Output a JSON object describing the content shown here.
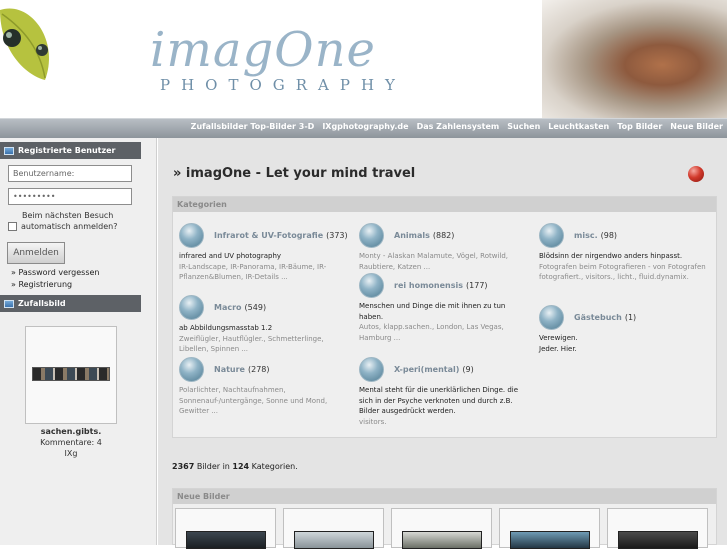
{
  "header": {
    "logo_text": "imagOne",
    "logo_subtitle": "PHOTOGRAPHY"
  },
  "nav": {
    "items": [
      "Zufallsbilder Top-Bilder 3-D",
      "IXgphotography.de",
      "Das Zahlensystem",
      "Suchen",
      "Leuchtkasten",
      "Top Bilder",
      "Neue Bilder"
    ]
  },
  "sidebar": {
    "login_header": "Registrierte Benutzer",
    "username_placeholder": "Benutzername:",
    "password_value": "•••••••••",
    "remember_line1": "Beim nächsten Besuch",
    "remember_line2": "automatisch anmelden?",
    "login_button": "Anmelden",
    "link_forgot": "» Password vergessen",
    "link_register": "» Registrierung",
    "random_header": "Zufallsbild",
    "random_title": "sachen.gibts.",
    "random_comments": "Kommentare: 4",
    "random_author": "IXg"
  },
  "main": {
    "title": "» imagOne - Let your mind travel",
    "categories_label": "Kategorien",
    "categories": [
      {
        "name": "Infrarot & UV-Fotografie",
        "count": "(373)",
        "desc": "infrared and UV photography",
        "subs": "IR-Landscape, IR-Panorama, IR-Bäume, IR-Pflanzen&Blumen, IR-Details ..."
      },
      {
        "name": "Animals",
        "count": "(882)",
        "desc": "",
        "subs": "Monty - Alaskan Malamute, Vögel, Rotwild, Raubtiere, Katzen ..."
      },
      {
        "name": "misc.",
        "count": "(98)",
        "desc": "Blödsinn der nirgendwo anders hinpasst.",
        "subs": "Fotografen beim Fotografieren - von Fotografen fotografiert., visitors., licht., fluid.dynamix."
      },
      {
        "name": "Macro",
        "count": "(549)",
        "desc": "ab Abbildungsmasstab 1.2",
        "subs": "Zweiflügler, Hautflügler., Schmetterlinge, Libellen, Spinnen ..."
      },
      {
        "name": "rei homonensis",
        "count": "(177)",
        "desc": "Menschen und Dinge die mit ihnen zu tun haben.",
        "subs": "Autos, klapp.sachen., London, Las Vegas, Hamburg ..."
      },
      {
        "name": "Gästebuch",
        "count": "(1)",
        "desc": "Verewigen. Jeder. Hier.",
        "subs": ""
      },
      {
        "name": "Nature",
        "count": "(278)",
        "desc": "",
        "subs": "Polarlichter, Nachtaufnahmen, Sonnenauf-/untergänge, Sonne und Mond, Gewitter ..."
      },
      {
        "name": "X-peri(mental)",
        "count": "(9)",
        "desc": "Mental steht für die unerklärlichen Dinge. die sich in der Psyche verknoten und durch z.B. Bilder ausgedrückt werden.",
        "subs": "visitors."
      }
    ],
    "stats_images": "2367",
    "stats_mid": "Bilder in",
    "stats_cats": "124",
    "stats_end": "Kategorien.",
    "new_label": "Neue Bilder"
  },
  "colors": {
    "nav_bar": "#9aa1a8",
    "sidebar_header": "#5d6166",
    "category_link": "#7a8a98",
    "accent_ball": "#d23a2c"
  }
}
